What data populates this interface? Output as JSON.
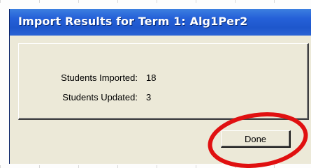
{
  "dialog": {
    "title": "Import Results for Term 1: Alg1Per2",
    "stats": [
      {
        "label": "Students Imported:",
        "value": "18"
      },
      {
        "label": "Students Updated:",
        "value": "3"
      }
    ],
    "done_label": "Done"
  },
  "colors": {
    "titlebar": "#1e57cc",
    "dialog_bg": "#ece9d8",
    "annotation_circle": "#e01010"
  },
  "annotation": {
    "shape": "circle",
    "target": "done-button"
  }
}
